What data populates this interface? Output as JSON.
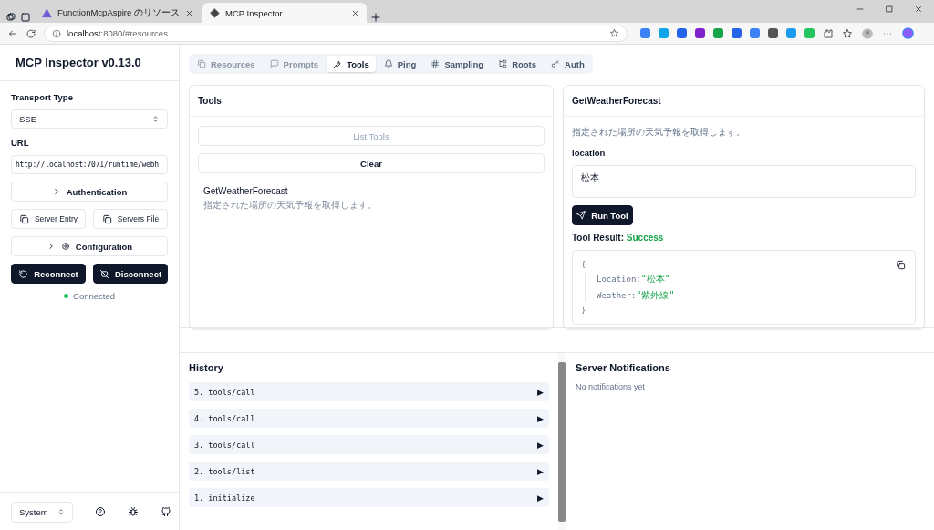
{
  "browser": {
    "tabs": [
      {
        "title": "FunctionMcpAspire のリソース",
        "selected": false
      },
      {
        "title": "MCP Inspector",
        "selected": true
      }
    ],
    "url_host": "localhost",
    "url_rest": ":8080/#resources"
  },
  "sidebar": {
    "title": "MCP Inspector v0.13.0",
    "transport_label": "Transport Type",
    "transport_value": "SSE",
    "url_label": "URL",
    "url_value": "http://localhost:7071/runtime/webh",
    "authentication": "Authentication",
    "server_entry": "Server Entry",
    "servers_file": "Servers File",
    "configuration": "Configuration",
    "reconnect": "Reconnect",
    "disconnect": "Disconnect",
    "status": "Connected",
    "connected": true,
    "theme": "System"
  },
  "tabs": [
    {
      "label": "Resources",
      "selected": false,
      "disabled": true
    },
    {
      "label": "Prompts",
      "selected": false,
      "disabled": true
    },
    {
      "label": "Tools",
      "selected": true,
      "disabled": false
    },
    {
      "label": "Ping",
      "selected": false,
      "disabled": false
    },
    {
      "label": "Sampling",
      "selected": false,
      "disabled": false
    },
    {
      "label": "Roots",
      "selected": false,
      "disabled": false
    },
    {
      "label": "Auth",
      "selected": false,
      "disabled": false
    }
  ],
  "tools_panel": {
    "title": "Tools",
    "list_button": {
      "label": "List Tools",
      "disabled": true
    },
    "clear_button": "Clear",
    "tools": [
      {
        "name": "GetWeatherForecast",
        "description": "指定された場所の天気予報を取得します。"
      }
    ]
  },
  "detail": {
    "title": "GetWeatherForecast",
    "description": "指定された場所の天気予報を取得します。",
    "param_label": "location",
    "param_value": "松本",
    "run_button": "Run Tool",
    "result_label": "Tool Result:",
    "result_status": "Success",
    "result_json": {
      "open": "{",
      "close": "}",
      "entries": [
        {
          "key": "Location:",
          "value": "\"松本\""
        },
        {
          "key": "Weather:",
          "value": "\"紫外線\""
        }
      ]
    }
  },
  "history": {
    "title": "History",
    "items": [
      {
        "label": "5. tools/call",
        "glyph": "▶"
      },
      {
        "label": "4. tools/call",
        "glyph": "▶"
      },
      {
        "label": "3. tools/call",
        "glyph": "▶"
      },
      {
        "label": "2. tools/list",
        "glyph": "▶"
      },
      {
        "label": "1. initialize",
        "glyph": "▶"
      }
    ]
  },
  "notifications": {
    "title": "Server Notifications",
    "empty": "No notifications yet"
  }
}
